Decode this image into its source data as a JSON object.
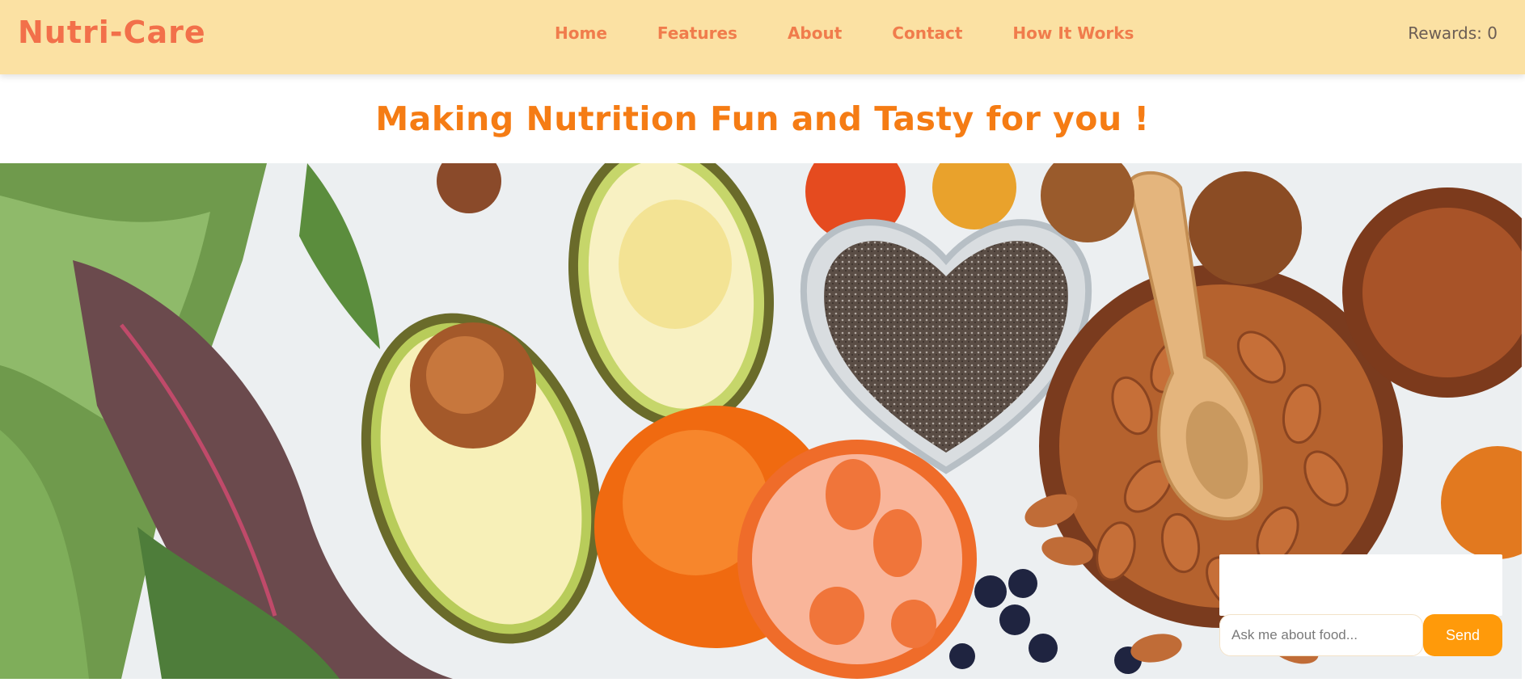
{
  "brand": {
    "name": "Nutri-Care"
  },
  "nav": {
    "items": [
      {
        "label": "Home"
      },
      {
        "label": "Features"
      },
      {
        "label": "About"
      },
      {
        "label": "Contact"
      },
      {
        "label": "How It Works"
      }
    ]
  },
  "rewards": {
    "text": "Rewards: 0"
  },
  "hero": {
    "headline": "Making Nutrition Fun and Tasty for you !",
    "image_subject": "healthy food flat lay: leafy greens, avocado halves, tomatoes, chia seeds in heart bowl, almonds with wooden scoop, walnuts, pecans, blueberries"
  },
  "chat": {
    "placeholder": "Ask me about food...",
    "send_label": "Send"
  },
  "colors": {
    "navbar_bg": "#fbe1a3",
    "brand": "#f2704a",
    "nav_link": "#f07c4c",
    "headline": "#f57c14",
    "send_button": "#ff9a0a"
  }
}
